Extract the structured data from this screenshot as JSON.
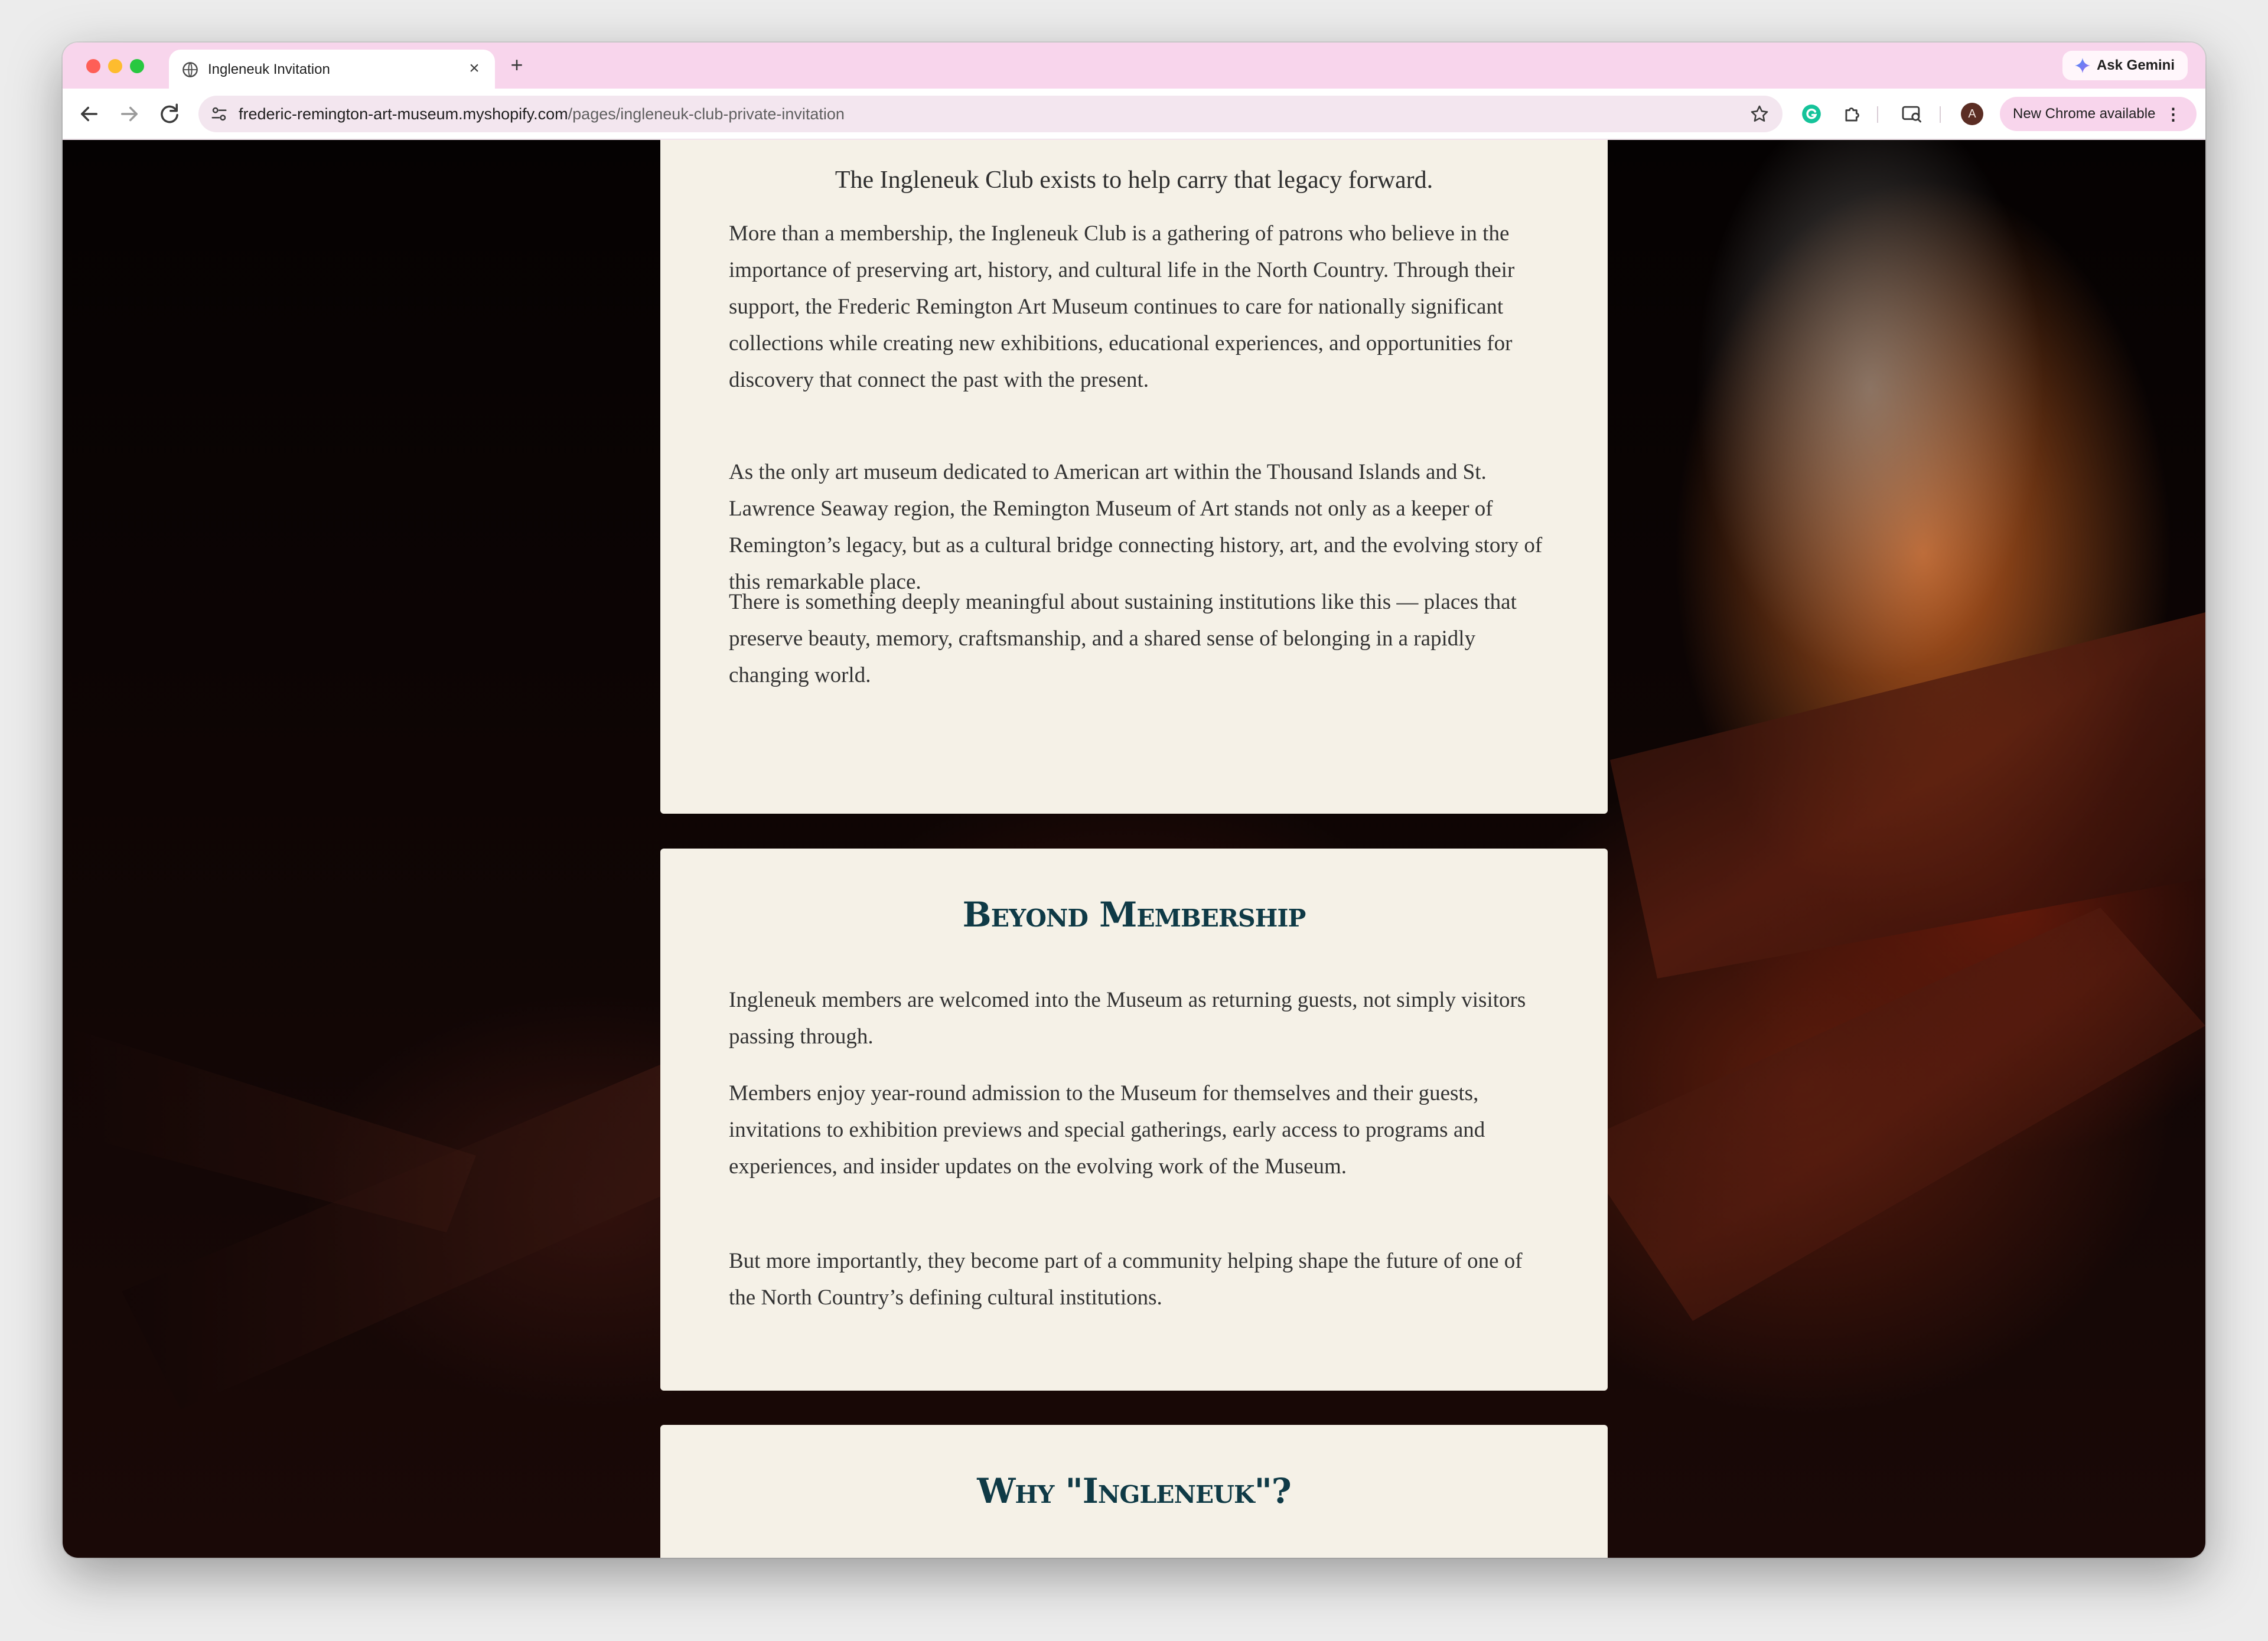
{
  "browser": {
    "tab_title": "Ingleneuk Invitation",
    "new_tab_label": "+",
    "tab_close_label": "×",
    "gemini_label": "Ask Gemini",
    "url_host": "frederic-remington-art-museum.myshopify.com",
    "url_path": "/pages/ingleneuk-club-private-invitation",
    "avatar_initial": "A",
    "update_label": "New Chrome available",
    "menu_label": "⋮",
    "icons": {
      "back": "arrow-left-icon",
      "forward": "arrow-right-icon",
      "reload": "reload-icon",
      "site_info": "tune-icon",
      "bookmark": "star-icon",
      "grammarly": "grammarly-icon",
      "extensions": "puzzle-icon",
      "lens": "lens-icon"
    },
    "colors": {
      "tabstrip": "#f8d5ec",
      "omnibox": "#f3e6ef",
      "traffic_red": "#fe5f57",
      "traffic_yellow": "#febc2e",
      "traffic_green": "#28c840"
    }
  },
  "page": {
    "colors": {
      "card_bg": "#f5f1e7",
      "heading": "#0f3a46",
      "body_text": "#333333"
    },
    "section_legacy": {
      "lede": "The Ingleneuk Club exists to help carry that legacy forward.",
      "paragraphs": [
        "More than a membership, the Ingleneuk Club is a gathering of patrons who believe in the importance of preserving art, history, and cultural life in the North Country. Through their support, the Frederic Remington Art Museum continues to care for nationally significant collections while creating new exhibitions, educational experiences, and opportunities for discovery that connect the past with the present.",
        "As the only art museum dedicated to American art within the Thousand Islands and St. Lawrence Seaway region, the Remington Museum of Art stands not only as a keeper of Remington’s legacy, but as a cultural bridge connecting history, art, and the evolving story of this remarkable place.",
        "There is something deeply meaningful about sustaining institutions like this — places that preserve beauty, memory, craftsmanship, and a shared sense of belonging in a rapidly changing world."
      ]
    },
    "section_beyond": {
      "heading": "Beyond Membership",
      "paragraphs": [
        "Ingleneuk members are welcomed into the Museum as returning guests, not simply visitors passing through.",
        "Members enjoy year-round admission to the Museum for themselves and their guests, invitations to exhibition previews and special gatherings, early access to programs and experiences, and insider updates on the evolving work of the Museum.",
        "But more importantly, they become part of a community helping shape the future of one of the North Country’s defining cultural institutions."
      ]
    },
    "section_why": {
      "heading": "Why \"Ingleneuk\"?"
    }
  }
}
